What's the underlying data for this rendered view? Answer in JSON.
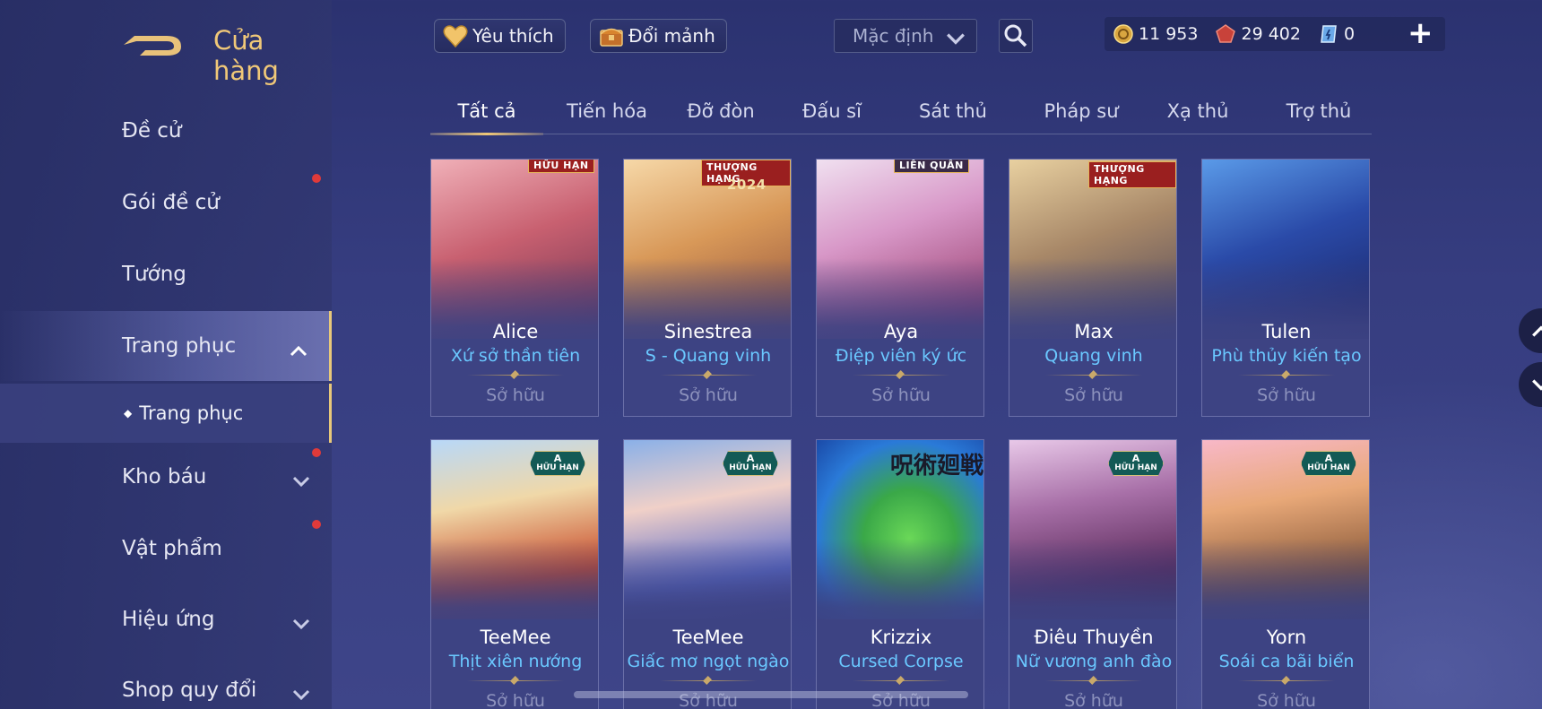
{
  "header": {
    "title": "Cửa hàng",
    "favorite_label": "Yêu thích",
    "exchange_label": "Đổi mảnh",
    "sort_value": "Mặc định",
    "currencies": [
      {
        "icon": "gold-coin-icon",
        "value": "11 953"
      },
      {
        "icon": "red-gem-icon",
        "value": "29 402"
      },
      {
        "icon": "voucher-icon",
        "value": "0"
      }
    ],
    "plus_label": "+"
  },
  "sidebar": {
    "items": [
      {
        "label": "Đề cử"
      },
      {
        "label": "Gói đề cử"
      },
      {
        "label": "Tướng"
      },
      {
        "label": "Trang phục"
      },
      {
        "label": "Kho báu"
      },
      {
        "label": "Vật phẩm"
      },
      {
        "label": "Hiệu ứng"
      },
      {
        "label": "Shop quy đổi"
      }
    ],
    "sub_item": "Trang phục",
    "bullet": "◆"
  },
  "tabs": [
    "Tất cả",
    "Tiến hóa",
    "Đỡ đòn",
    "Đấu sĩ",
    "Sát thủ",
    "Pháp sư",
    "Xạ thủ",
    "Trợ thủ"
  ],
  "cards": [
    {
      "name": "Alice",
      "skin": "Xứ sở thần tiên",
      "status": "Sở hữu",
      "badge": "HỮU HẠN",
      "art_top": "#e8a0a0",
      "art_bottom": "#7a3a55"
    },
    {
      "name": "Sinestrea",
      "skin": "S - Quang vinh",
      "status": "Sở hữu",
      "badge": "THƯỢNG HẠNG",
      "badge2": "2024",
      "art_top": "#f0c89a",
      "art_bottom": "#a8603a"
    },
    {
      "name": "Aya",
      "skin": "Điệp viên ký ức",
      "status": "Sở hữu",
      "badge": "LIÊN QUÂN",
      "art_top": "#e8c8e8",
      "art_bottom": "#8a3a6a"
    },
    {
      "name": "Max",
      "skin": "Quang vinh",
      "status": "Sở hữu",
      "badge": "THƯỢNG HẠNG",
      "art_top": "#d8b888",
      "art_bottom": "#5a4a4a"
    },
    {
      "name": "Tulen",
      "skin": "Phù thủy kiến tạo",
      "status": "Sở hữu",
      "badge": "",
      "art_top": "#3a6ac8",
      "art_bottom": "#1a2a6a"
    },
    {
      "name": "TeeMee",
      "skin": "Thịt xiên nướng",
      "status": "Sở hữu",
      "badge_a": "A",
      "badge_a_text": "HỮU HẠN",
      "art_top": "#f0e0b8",
      "art_bottom": "#c84a2a"
    },
    {
      "name": "TeeMee",
      "skin": "Giấc mơ ngọt ngào",
      "status": "Sở hữu",
      "badge_a": "A",
      "badge_a_text": "HỮU HẠN",
      "art_top": "#a8c8f0",
      "art_bottom": "#4a5ab0"
    },
    {
      "name": "Krizzix",
      "skin": "Cursed Corpse",
      "status": "Sở hữu",
      "corner_text": "呪術廻戦",
      "art_top": "#3a9ad8",
      "art_bottom": "#3aa84a"
    },
    {
      "name": "Điêu Thuyền",
      "skin": "Nữ vương anh đào",
      "status": "Sở hữu",
      "badge_a": "A",
      "badge_a_text": "HỮU HẠN",
      "art_top": "#c8a0c8",
      "art_bottom": "#5a2a5a"
    },
    {
      "name": "Yorn",
      "skin": "Soái ca bãi biển",
      "status": "Sở hữu",
      "badge_a": "A",
      "badge_a_text": "HỮU HẠN",
      "art_top": "#f0a8b8",
      "art_bottom": "#6a4a3a"
    }
  ],
  "colors": {
    "accent_gold": "#f0c878",
    "skin_name_blue": "#6ac8ff",
    "owned_grey": "#8d92bd",
    "notification_red": "#e03a3a"
  }
}
